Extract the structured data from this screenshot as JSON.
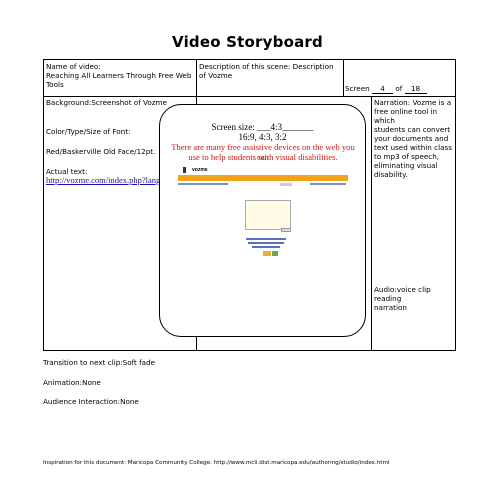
{
  "title": "Video Storyboard",
  "name_of_video": {
    "label": "Name of video:",
    "value_line1": "Reaching All Learners Through Free Web",
    "value_line2": "Tools"
  },
  "scene_description": "Description of this scene: Description of Vozme",
  "screen_counter": {
    "screen_label": "Screen",
    "current": "4",
    "of_label": "of",
    "total": "18"
  },
  "background": "Background:Screenshot of Vozme",
  "font_info": "Color/Type/Size of Font:",
  "font_value": "Red/Baskerville Old Face/12pt.",
  "actual_text_label": "Actual text:",
  "actual_text_link": "http://vozme.com/index.php?lang=en",
  "frame": {
    "screen_size_line1": "Screen size: ___4:3_______",
    "screen_size_line2": "16:9, 4:3, 3:2",
    "red_line1": "There are many free assistive devices on the web you can",
    "red_line2": "use to help students with visual disabilities.",
    "vozme_logo": "vozme"
  },
  "narration": {
    "line1": "Narration: Vozme is a",
    "line2": "free online tool in which",
    "line3": "students can convert",
    "line4": "your documents and",
    "line5": "text used within class",
    "line6": "to mp3 of speech,",
    "line7": "eliminating visual",
    "line8": "disability."
  },
  "audio": {
    "line1": "Audio:voice clip reading",
    "line2": "narration"
  },
  "transition": "Transition to next clip:Soft fade",
  "animation": "Animation:None",
  "audience_interaction": "Audience Interaction:None",
  "footer": "Inspiration for this document: Maricopa Community College. http://www.mcli.dist.maricopa.edu/authoring/studio/index.html"
}
